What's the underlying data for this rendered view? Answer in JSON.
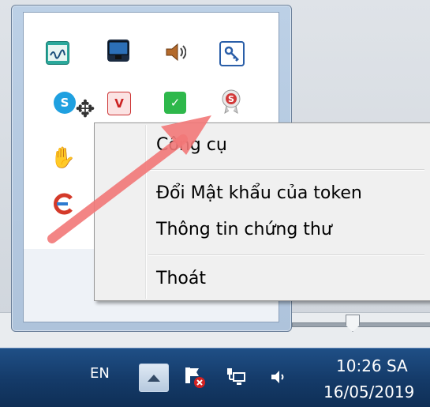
{
  "context_menu": {
    "items": [
      {
        "label": "Công cụ"
      },
      {
        "label": "Đổi Mật khẩu của token"
      },
      {
        "label": "Thông tin chứng thư"
      },
      {
        "label": "Thoát"
      }
    ]
  },
  "tray_icons": [
    "signature-icon",
    "monitor-icon",
    "speaker-icon",
    "key-icon",
    "skype-icon",
    "v-icon",
    "shield-check-icon",
    "seal-icon",
    "hand-icon",
    "ccleaner-icon"
  ],
  "taskbar": {
    "language": "EN",
    "time": "10:26 SA",
    "date": "16/05/2019"
  },
  "colors": {
    "taskbar": "#143a68",
    "menu_bg": "#f0f0f0",
    "arrow": "#f07a7a"
  }
}
